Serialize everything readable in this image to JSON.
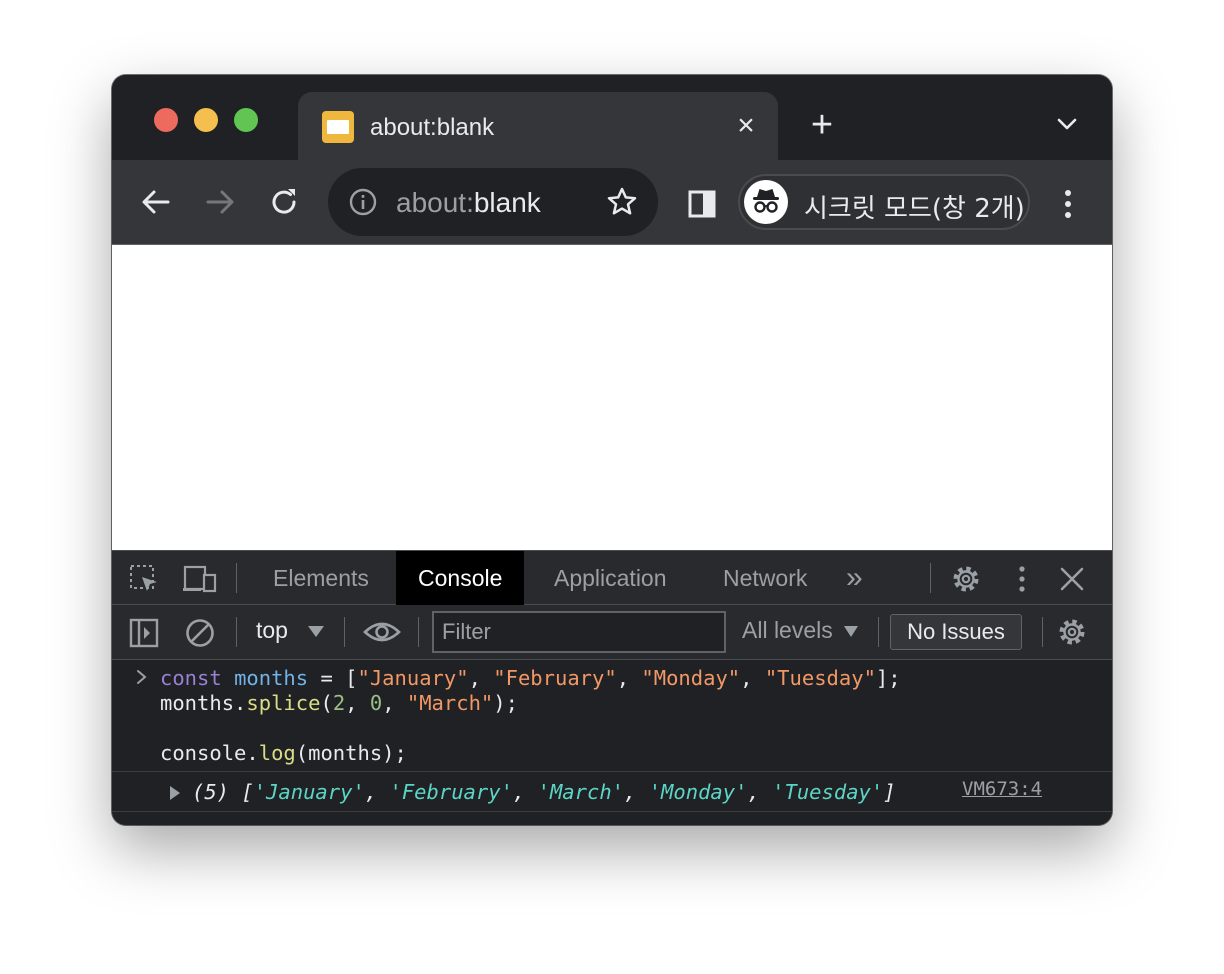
{
  "tab": {
    "title": "about:blank",
    "close": "×",
    "new_tab": "+"
  },
  "omnibox": {
    "scheme": "about:",
    "host": "blank"
  },
  "incognito": {
    "label": "시크릿 모드(창 2개)"
  },
  "devtools": {
    "tabs": [
      {
        "label": "Elements"
      },
      {
        "label": "Console"
      },
      {
        "label": "Application"
      },
      {
        "label": "Network"
      }
    ],
    "active_tab": "Console",
    "more_tabs": "»"
  },
  "console": {
    "context": "top",
    "filter_placeholder": "Filter",
    "levels": "All levels",
    "issues": "No Issues",
    "input": {
      "line1": {
        "kw": "const",
        "var": "months",
        "eq": " = [",
        "s1": "\"January\"",
        "s2": "\"February\"",
        "s3": "\"Monday\"",
        "s4": "\"Tuesday\"",
        "end": "];"
      },
      "line2": {
        "obj": "months.",
        "fn": "splice",
        "open": "(",
        "n1": "2",
        "n2": "0",
        "s": "\"March\"",
        "close": ");"
      },
      "line3": {
        "obj": "console.",
        "fn": "log",
        "args": "(months);"
      }
    },
    "output": {
      "prefix": "(5) [",
      "items": [
        "'January'",
        "'February'",
        "'March'",
        "'Monday'",
        "'Tuesday'"
      ],
      "suffix": "]",
      "source": "VM673:4"
    }
  },
  "colors": {
    "traffic_red": "#ed6a5e",
    "traffic_yellow": "#f5bf4f",
    "traffic_green": "#61c554",
    "string": "#f29766",
    "keyword": "#9a7fd5",
    "output_string": "#5cd5c6"
  }
}
